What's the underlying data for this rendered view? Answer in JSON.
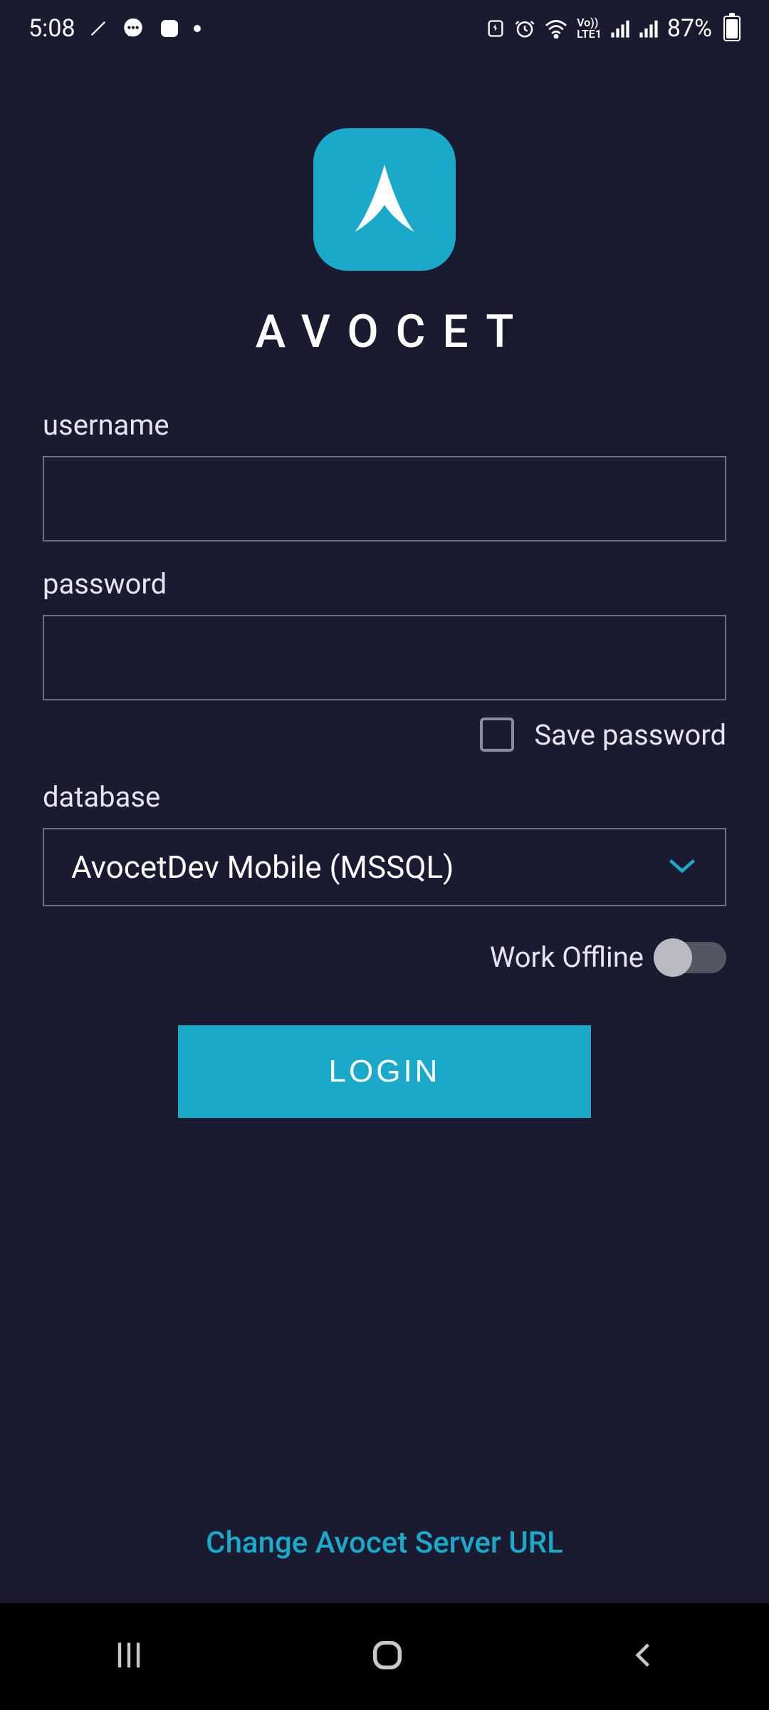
{
  "status": {
    "time": "5:08",
    "battery": "87%"
  },
  "brand": {
    "name": "AVOCET"
  },
  "form": {
    "username_label": "username",
    "username_value": "",
    "password_label": "password",
    "password_value": "",
    "save_password_label": "Save password",
    "database_label": "database",
    "database_value": "AvocetDev Mobile (MSSQL)",
    "work_offline_label": "Work Offline",
    "login_button": "LOGIN"
  },
  "footer": {
    "change_url": "Change Avocet Server URL"
  }
}
